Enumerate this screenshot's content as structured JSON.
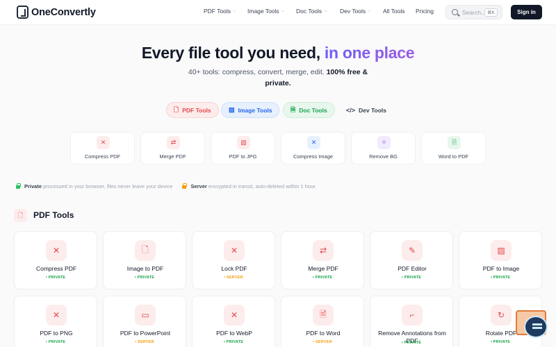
{
  "header": {
    "logo_text": "OneConvertly",
    "nav": [
      {
        "label": "PDF Tools",
        "has_dropdown": true
      },
      {
        "label": "Image Tools",
        "has_dropdown": true
      },
      {
        "label": "Doc Tools",
        "has_dropdown": true
      },
      {
        "label": "Dev Tools",
        "has_dropdown": true
      },
      {
        "label": "All Tools",
        "has_dropdown": false
      },
      {
        "label": "Pricing",
        "has_dropdown": false
      }
    ],
    "search_placeholder": "Search...",
    "search_shortcut": "⌘K",
    "signin_label": "Sign in"
  },
  "hero": {
    "title_main": "Every file tool you need,",
    "title_accent": "in one place",
    "subtitle": "40+ tools: compress, convert, merge, edit.",
    "subtitle_bold": "100% free & private."
  },
  "category_tabs": [
    {
      "label": "PDF Tools",
      "icon": "file-icon",
      "color": "#e5484d",
      "bg": "#fdecec"
    },
    {
      "label": "Image Tools",
      "icon": "image-icon",
      "color": "#2563eb",
      "bg": "#e7f0fd"
    },
    {
      "label": "Doc Tools",
      "icon": "doc-icon",
      "color": "#16a34a",
      "bg": "#e8f7ee"
    },
    {
      "label": "Dev Tools",
      "icon": "code-icon",
      "color": "#374151",
      "bg": "#fafafa"
    }
  ],
  "quick_tools": [
    {
      "label": "Compress PDF",
      "icon": "compress-icon",
      "color": "#e5484d",
      "bg": "#fdecec"
    },
    {
      "label": "Merge PDF",
      "icon": "merge-icon",
      "color": "#e5484d",
      "bg": "#fdecec"
    },
    {
      "label": "PDF to JPG",
      "icon": "image-icon",
      "color": "#e5484d",
      "bg": "#fdecec"
    },
    {
      "label": "Compress Image",
      "icon": "compress-icon",
      "color": "#2563eb",
      "bg": "#e7f0fd"
    },
    {
      "label": "Remove BG",
      "icon": "sparkle-icon",
      "color": "#7c3aed",
      "bg": "#f1ebfd"
    },
    {
      "label": "Word to PDF",
      "icon": "doc-icon",
      "color": "#16a34a",
      "bg": "#e8f7ee"
    }
  ],
  "privacy": {
    "private_label": "Private",
    "private_text": "processed in your browser, files never leave your device",
    "server_label": "Server",
    "server_text": "encrypted in transit, auto-deleted within 1 hour"
  },
  "section": {
    "title": "PDF Tools"
  },
  "tools": [
    {
      "name": "Compress PDF",
      "badge": "• PRIVATE",
      "mode": "private",
      "icon": "compress-icon"
    },
    {
      "name": "Image to PDF",
      "badge": "• PRIVATE",
      "mode": "private",
      "icon": "file-icon"
    },
    {
      "name": "Lock PDF",
      "badge": "• SERVER",
      "mode": "server",
      "icon": "compress-icon"
    },
    {
      "name": "Merge PDF",
      "badge": "• PRIVATE",
      "mode": "private",
      "icon": "merge-icon"
    },
    {
      "name": "PDF Editor",
      "badge": "• PRIVATE",
      "mode": "private",
      "icon": "edit-icon"
    },
    {
      "name": "PDF to Image",
      "badge": "• PRIVATE",
      "mode": "private",
      "icon": "image-icon"
    },
    {
      "name": "PDF to PNG",
      "badge": "• PRIVATE",
      "mode": "private",
      "icon": "compress-icon"
    },
    {
      "name": "PDF to PowerPoint",
      "badge": "• SERVER",
      "mode": "server",
      "icon": "presentation-icon"
    },
    {
      "name": "PDF to WebP",
      "badge": "• PRIVATE",
      "mode": "private",
      "icon": "compress-icon"
    },
    {
      "name": "PDF to Word",
      "badge": "• SERVER",
      "mode": "server",
      "icon": "doc-icon"
    },
    {
      "name": "Remove Annotations from PDF",
      "badge": "• PRIVATE",
      "mode": "private",
      "icon": "annotation-icon"
    },
    {
      "name": "Rotate PDF",
      "badge": "• PRIVATE",
      "mode": "private",
      "icon": "rotate-icon"
    }
  ]
}
